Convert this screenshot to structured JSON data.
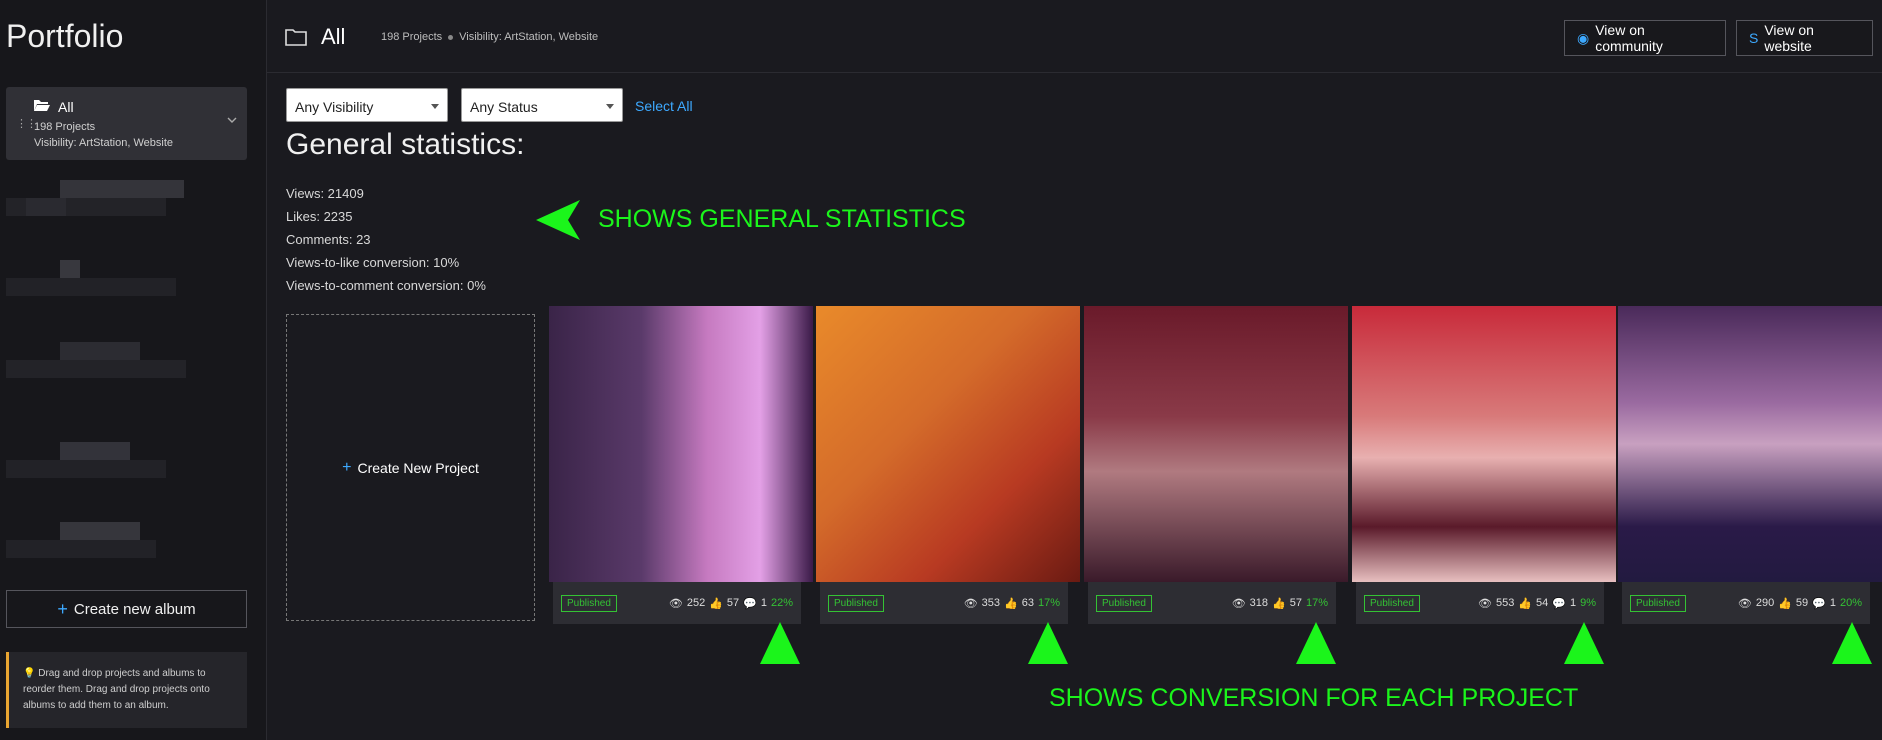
{
  "sidebar": {
    "title": "Portfolio",
    "album": {
      "name": "All",
      "count": "198 Projects",
      "visibility": "Visibility: ArtStation, Website"
    },
    "create_album_label": "Create new album",
    "hint": "Drag and drop projects and albums to reorder them. Drag and drop projects onto albums to add them to an album."
  },
  "header": {
    "title": "All",
    "projects": "198 Projects",
    "visibility": "Visibility: ArtStation, Website",
    "btn_community": "View on community",
    "btn_website": "View on website"
  },
  "filters": {
    "visibility": "Any Visibility",
    "status": "Any Status",
    "select_all": "Select All"
  },
  "stats": {
    "title": "General statistics:",
    "views": "Views: 21409",
    "likes": "Likes: 2235",
    "comments": "Comments: 23",
    "like_conv": "Views-to-like conversion: 10%",
    "comment_conv": "Views-to-comment conversion: 0%"
  },
  "annotations": {
    "general": "SHOWS GENERAL STATISTICS",
    "conversion": "SHOWS CONVERSION FOR EACH PROJECT"
  },
  "create_project_label": "Create New Project",
  "projects": [
    {
      "status": "Published",
      "views": "252",
      "likes": "57",
      "comments": "1",
      "conv": "22%"
    },
    {
      "status": "Published",
      "views": "353",
      "likes": "63",
      "comments": "",
      "conv": "17%"
    },
    {
      "status": "Published",
      "views": "318",
      "likes": "57",
      "comments": "",
      "conv": "17%"
    },
    {
      "status": "Published",
      "views": "553",
      "likes": "54",
      "comments": "1",
      "conv": "9%"
    },
    {
      "status": "Published",
      "views": "290",
      "likes": "59",
      "comments": "1",
      "conv": "20%"
    }
  ]
}
